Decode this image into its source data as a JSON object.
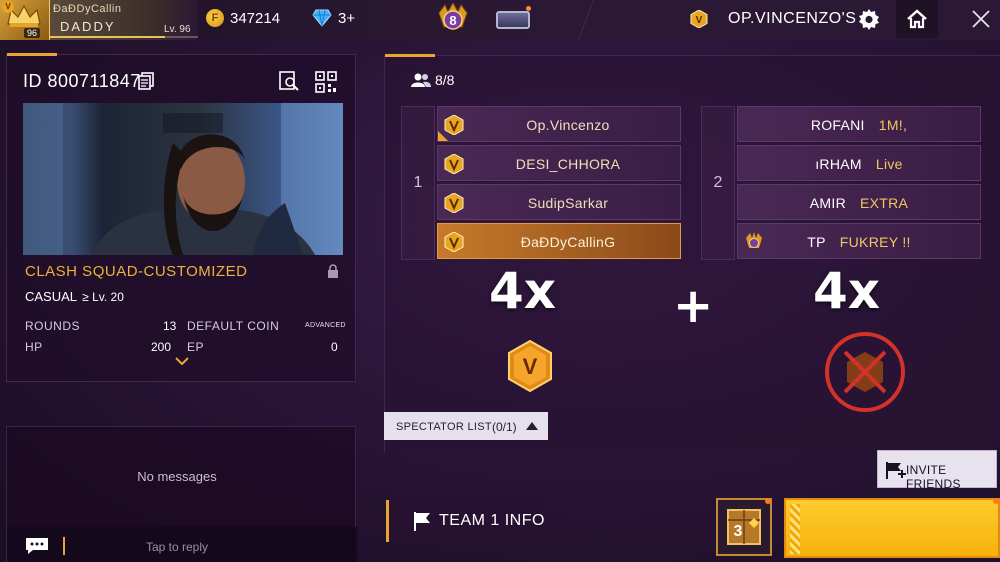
{
  "topbar": {
    "player_name_line1": "ĐaĐDyCallin",
    "player_name_line2": "DADDY",
    "player_level": "Lv. 96",
    "avatar_level": "96",
    "avatar_badge": "V",
    "xp_progress": 0.78,
    "coins": "347214",
    "coin_symbol": "F",
    "diamonds": "3+",
    "rank_number": "8",
    "host_name": "OP.VINCENZO'S",
    "icons": [
      "crown-avatar-icon",
      "gold-coin-icon",
      "diamond-icon",
      "rank-badge-icon",
      "mail-icon",
      "v-badge-icon",
      "gear-icon",
      "home-icon",
      "close-icon"
    ]
  },
  "room": {
    "id_label": "ID",
    "id_value": "800711847",
    "mode": "CLASH SQUAD-CUSTOMIZED",
    "sub_mode": "CASUAL",
    "level_req": "≥ Lv. 20",
    "stats": {
      "rounds_label": "ROUNDS",
      "rounds_value": "13",
      "default_coin_label": "DEFAULT COIN",
      "default_coin_value": "ADVANCED",
      "hp_label": "HP",
      "hp_value": "200",
      "ep_label": "EP",
      "ep_value": "0"
    }
  },
  "chat": {
    "empty_text": "No messages",
    "placeholder": "Tap to reply"
  },
  "team": {
    "players_count": "8/8",
    "team1_index": "1",
    "team2_index": "2",
    "team1": [
      "Op.Vincenzo",
      "DESI_CHHORA",
      "SudipSarkar",
      "ĐaĐDyCallinG"
    ],
    "team2": [
      {
        "name": "ROFANI",
        "tag": "1M!,"
      },
      {
        "name": "ıRHAM",
        "tag": "Live"
      },
      {
        "name": "AMIR",
        "tag": "EXTRA"
      },
      {
        "name": "TP",
        "tag": "FUKREY  !!"
      }
    ],
    "team1_multiplier": "4x",
    "team2_multiplier": "4x",
    "plus": "+",
    "v_badge_letter": "V"
  },
  "spectator": {
    "label": "SPECTATOR LIST",
    "count": "(0/1)"
  },
  "buttons": {
    "invite_friends": "INVITE FRIENDS",
    "team_info": "TEAM 1 INFO",
    "crate_number": "3"
  },
  "colors": {
    "accent_gold": "#e8a630",
    "start_yellow": "#ffcb2e",
    "self_slot": "#c77a2a",
    "background": "#2a1538"
  }
}
